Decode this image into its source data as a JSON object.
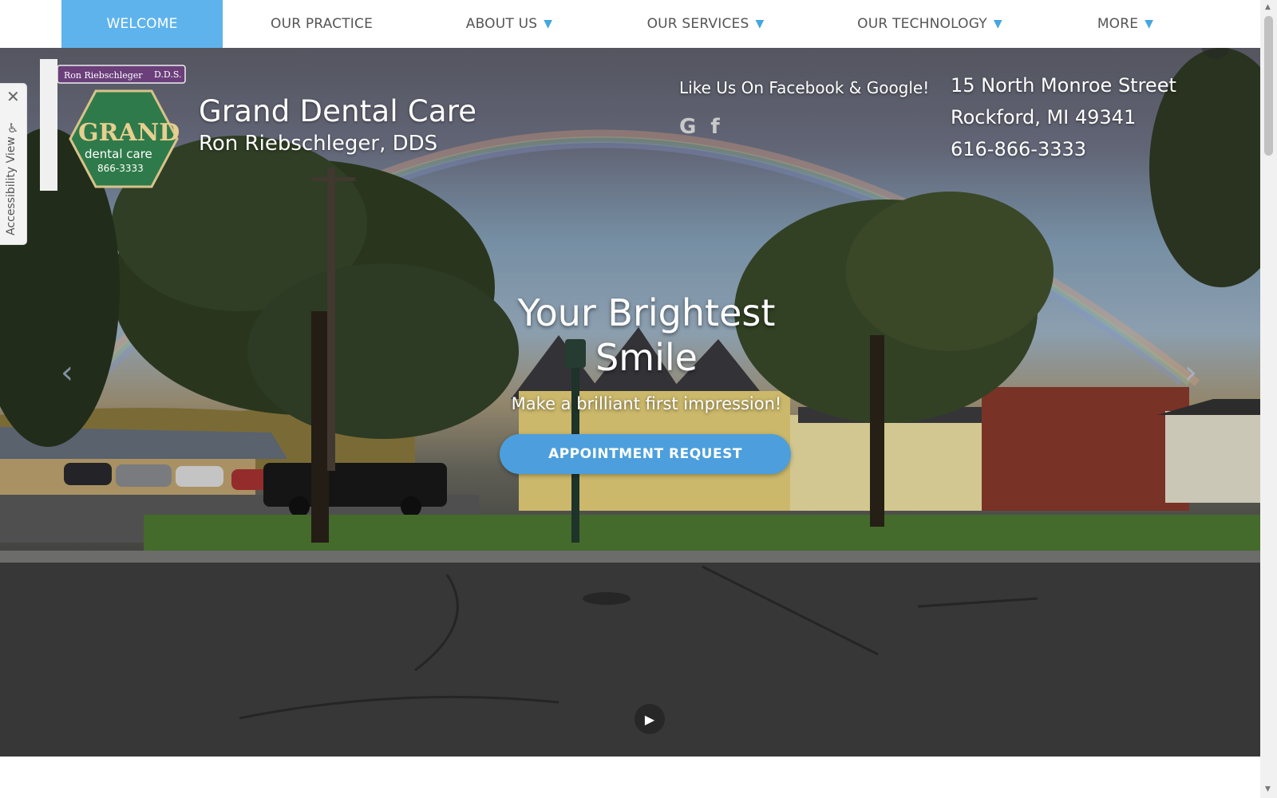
{
  "nav": {
    "items": [
      {
        "label": "WELCOME",
        "active": true,
        "dropdown": false
      },
      {
        "label": "OUR PRACTICE",
        "active": false,
        "dropdown": false
      },
      {
        "label": "ABOUT US",
        "active": false,
        "dropdown": true
      },
      {
        "label": "OUR SERVICES",
        "active": false,
        "dropdown": true
      },
      {
        "label": "OUR TECHNOLOGY",
        "active": false,
        "dropdown": true
      },
      {
        "label": "MORE",
        "active": false,
        "dropdown": true
      }
    ],
    "caret": "▼"
  },
  "logo": {
    "sign_top": "Ron Riebschleger",
    "sign_degree": "D.D.S.",
    "sign_name": "GRAND",
    "sign_sub": "dental care",
    "sign_phone": "866-3333"
  },
  "brand": {
    "name": "Grand Dental Care",
    "doctor": "Ron Riebschleger, DDS"
  },
  "social": {
    "title": "Like Us On Facebook & Google!",
    "google_glyph": "G",
    "facebook_glyph": "f"
  },
  "address": {
    "street": "15 North Monroe Street",
    "city": "Rockford, MI 49341",
    "phone": "616-866-3333"
  },
  "hero": {
    "headline_line1": "Your Brightest",
    "headline_line2": "Smile",
    "tagline": "Make a brilliant first impression!",
    "cta_label": "APPOINTMENT REQUEST",
    "prev_glyph": "‹",
    "next_glyph": "›",
    "play_glyph": "▶"
  },
  "accessibility": {
    "close_glyph": "✕",
    "icon_glyph": "♿",
    "label": "Accessibility View"
  },
  "colors": {
    "accent": "#5fb3ec",
    "cta": "#4c9fdc",
    "sign_green": "#2f7a4a",
    "sign_purple": "#6a3f7a"
  }
}
